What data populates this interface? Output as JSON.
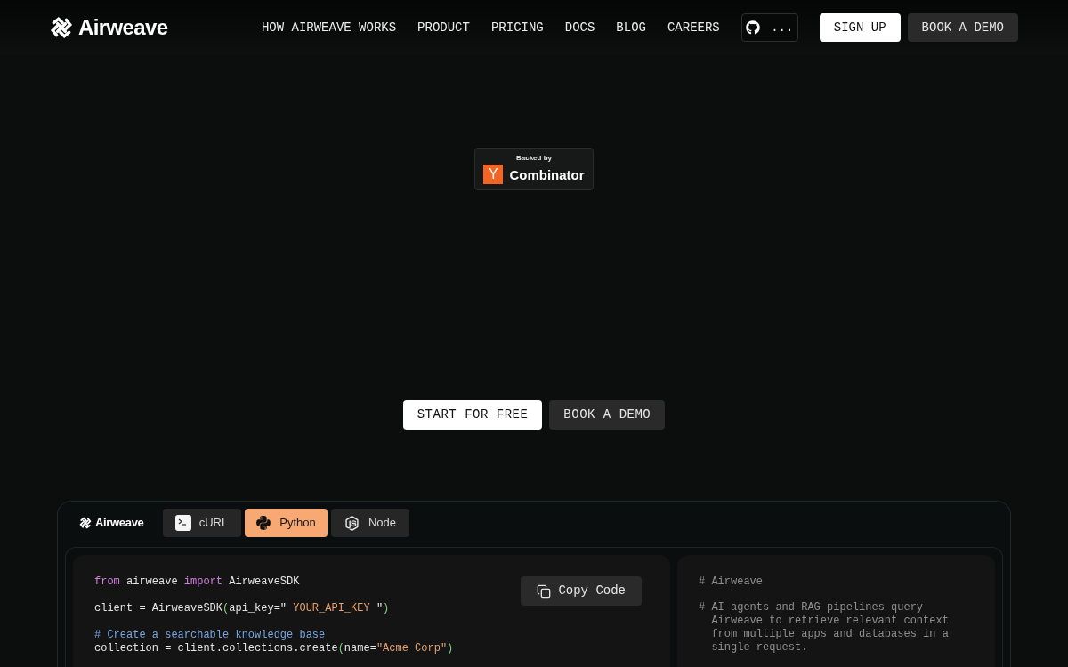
{
  "nav": {
    "logo": "Airweave",
    "links": [
      "HOW AIRWEAVE WORKS",
      "PRODUCT",
      "PRICING",
      "DOCS",
      "BLOG",
      "CAREERS"
    ],
    "github": {
      "label": "..."
    },
    "buttons": [
      {
        "label": "SIGN UP",
        "kind": "primary"
      },
      {
        "label": "BOOK A DEMO",
        "kind": "secondary"
      }
    ]
  },
  "badge": {
    "caption": "Backed by",
    "mark": "Y",
    "name": "Combinator"
  },
  "hero_buttons": [
    {
      "label": "START FOR FREE",
      "kind": "primary"
    },
    {
      "label": "BOOK A DEMO",
      "kind": "secondary"
    }
  ],
  "code_panel": {
    "logo": "Airweave",
    "tabs": [
      {
        "label": "cURL",
        "kind": "shell",
        "selected": false
      },
      {
        "label": "Python",
        "kind": "python",
        "selected": true
      },
      {
        "label": "Node",
        "kind": "javascript",
        "selected": false
      }
    ],
    "copy_button": "Copy Code",
    "blocks": [
      [
        [
          {
            "kind": "keyword",
            "text": "from"
          },
          {
            "kind": "plain",
            "text": " airweave "
          },
          {
            "kind": "keyword",
            "text": "import"
          },
          {
            "kind": "plain",
            "text": " AirweaveSDK"
          }
        ]
      ],
      [
        [
          {
            "kind": "plain",
            "text": "client = AirweaveSDK"
          },
          {
            "kind": "bracket",
            "text": "("
          },
          {
            "kind": "plain",
            "text": "api_key=\""
          },
          {
            "kind": "string",
            "text": " YOUR_API_KEY "
          },
          {
            "kind": "plain",
            "text": "\""
          },
          {
            "kind": "bracket",
            "text": ")"
          }
        ]
      ],
      [
        [
          {
            "kind": "comment",
            "text": "# Create a searchable knowledge base"
          }
        ],
        [
          {
            "kind": "plain",
            "text": "collection = client.collections.create"
          },
          {
            "kind": "bracket",
            "text": "("
          },
          {
            "kind": "plain",
            "text": "name="
          },
          {
            "kind": "string",
            "text": "\"Acme Corp\""
          },
          {
            "kind": "bracket",
            "text": ")"
          }
        ]
      ]
    ],
    "description": [
      "# Airweave",
      "# AI agents and RAG pipelines query Airweave to retrieve relevant context from multiple apps and databases in a single request."
    ]
  }
}
